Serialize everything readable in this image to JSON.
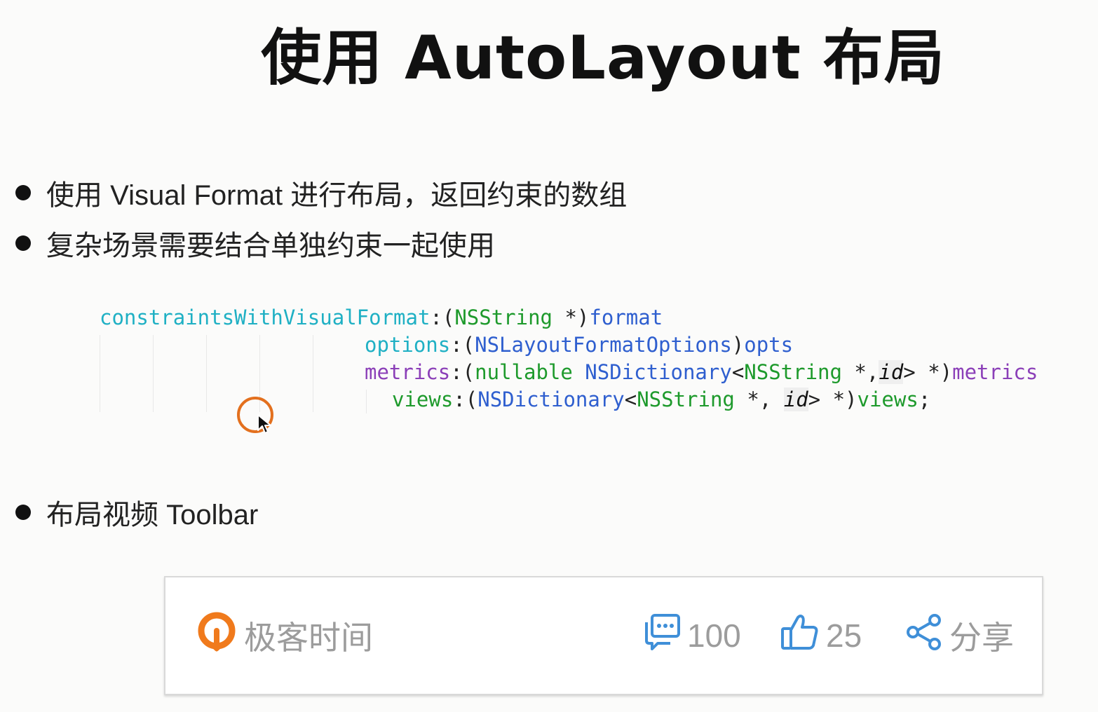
{
  "slide": {
    "title": "使用 AutoLayout 布局",
    "bullets": [
      "使用 Visual Format 进行布局，返回约束的数组",
      "复杂场景需要结合单独约束一起使用",
      "布局视频 Toolbar"
    ]
  },
  "code": {
    "line1": {
      "method": "constraintsWithVisualFormat",
      "colon": ":(",
      "type": "NSString",
      "star": " *)",
      "param": "format"
    },
    "line2": {
      "method": "options",
      "colon": ":(",
      "type": "NSLayoutFormatOptions",
      "close": ")",
      "param": "opts"
    },
    "line3": {
      "method": "metrics",
      "colon": ":(",
      "nullable": "nullable",
      "space": " ",
      "type": "NSDictionary",
      "lt": "<",
      "type2": "NSString",
      "star": " *,",
      "id": "id",
      "gt": "> *)",
      "param": "metrics"
    },
    "line4": {
      "method": "views",
      "colon": ":(",
      "type": "NSDictionary",
      "lt": "<",
      "type2": "NSString",
      "star": " *, ",
      "id": "id",
      "gt": "> *)",
      "param": "views",
      "semi": ";"
    }
  },
  "toolbar": {
    "brand": "极客时间",
    "comment_count": "100",
    "like_count": "25",
    "share_label": "分享",
    "icons": {
      "brand": "geektime-logo-icon",
      "comment": "comment-icon",
      "like": "thumbs-up-icon",
      "share": "share-icon"
    },
    "colors": {
      "brand": "#f07a1c",
      "icon": "#3f8fd8",
      "text": "#9c9c9c"
    }
  }
}
